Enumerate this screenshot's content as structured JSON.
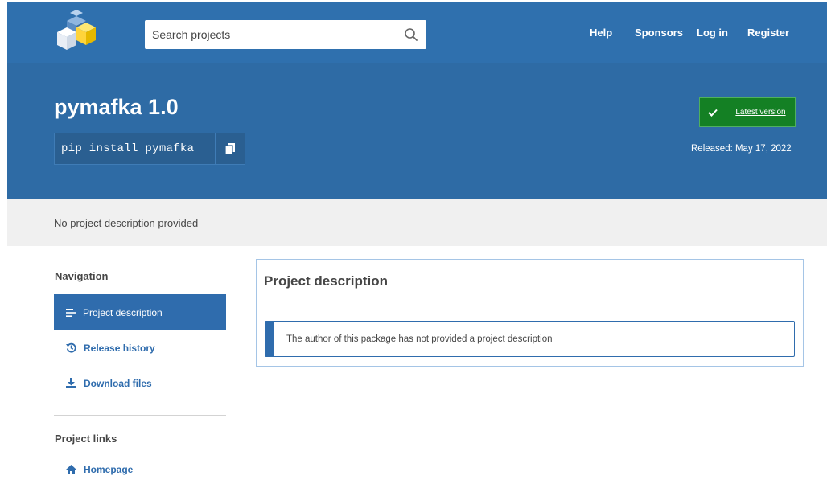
{
  "header": {
    "search_placeholder": "Search projects",
    "nav": [
      "Help",
      "Sponsors",
      "Log in",
      "Register"
    ]
  },
  "project": {
    "title": "pymafka 1.0",
    "pip_command": "pip install pymafka",
    "latest_label": "Latest version",
    "released": "Released: May 17, 2022",
    "summary": "No project description provided"
  },
  "sidebar": {
    "navigation_heading": "Navigation",
    "nav_items": [
      "Project description",
      "Release history",
      "Download files"
    ],
    "links_heading": "Project links",
    "links": [
      "Homepage"
    ]
  },
  "main": {
    "section_title": "Project description",
    "callout": "The author of this package has not provided a project description"
  },
  "colors": {
    "nav_bg": "#2f70ae",
    "hero_bg": "#2e6ba5",
    "accent": "#2f6cad",
    "badge_green": "#148024"
  },
  "icons": [
    "python-logo-icon",
    "search-icon",
    "copy-icon",
    "check-icon",
    "list-icon",
    "history-icon",
    "download-icon",
    "home-icon"
  ]
}
